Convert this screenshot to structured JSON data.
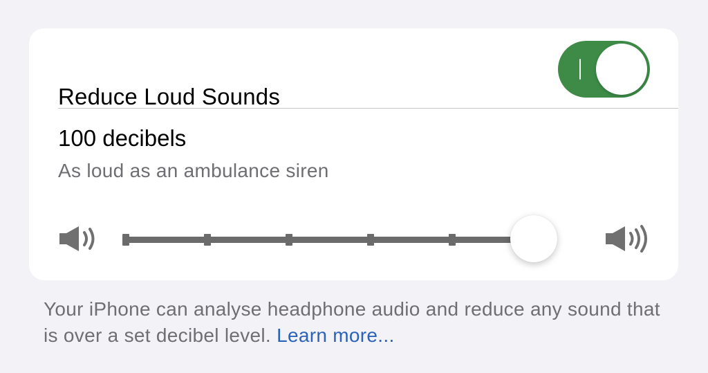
{
  "colors": {
    "accent": "#3d8b47",
    "link": "#2b63b8",
    "background": "#f2f2f7",
    "secondary_text": "#6e6e73"
  },
  "reduce_loud_sounds": {
    "label": "Reduce Loud Sounds",
    "enabled": true
  },
  "decibel_level": {
    "title": "100 decibels",
    "description": "As loud as an ambulance siren",
    "value": 100,
    "step_count": 6,
    "selected_step_fraction": 1.0,
    "min_icon": "speaker-low-volume-icon",
    "max_icon": "speaker-high-volume-icon"
  },
  "footer": {
    "text": "Your iPhone can analyse headphone audio and reduce any sound that is over a set decibel level.",
    "link_label": "Learn more..."
  }
}
